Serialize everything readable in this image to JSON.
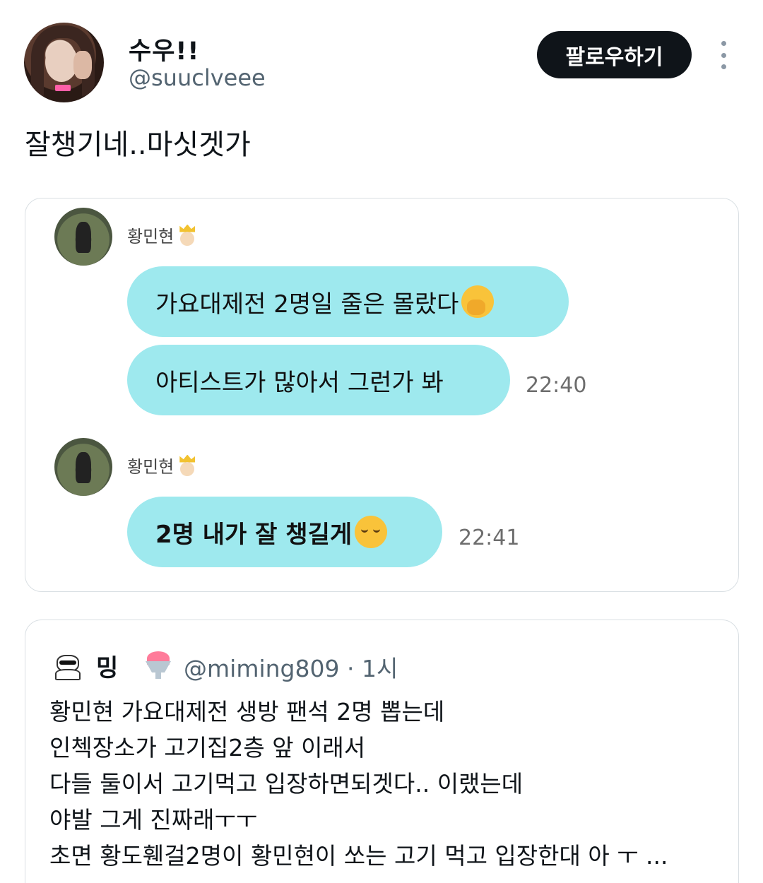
{
  "author": {
    "display_name": "수우!!",
    "handle": "@suuclveee",
    "follow_label": "팔로우하기"
  },
  "tweet": {
    "text": "잘챙기네..마싯겟가"
  },
  "chat": {
    "sender_name": "황민현",
    "messages": [
      {
        "text": "가요대제전 2명일 줄은 몰랐다",
        "emoji": "hand-over-mouth-icon"
      },
      {
        "text": "아티스트가 많아서 그런가 봐",
        "time": "22:40"
      },
      {
        "text": "2명 내가 잘 챙길게",
        "emoji": "relieved-face-icon",
        "time": "22:41"
      }
    ]
  },
  "quote": {
    "name": "밍",
    "handle_time": "@miming809 · 1시",
    "lines": [
      "황민현 가요대제전 생방 팬석 2명 뽑는데",
      "인첵장소가 고기집2층 앞 이래서",
      "다들 둘이서 고기먹고 입장하면되겟다.. 이랬는데",
      "야발 그게 진짜래ㅜㅜ",
      "초면 황도휀걸2명이 황민현이 쏘는 고기 먹고 입장한대 아 ㅜ ..."
    ]
  }
}
